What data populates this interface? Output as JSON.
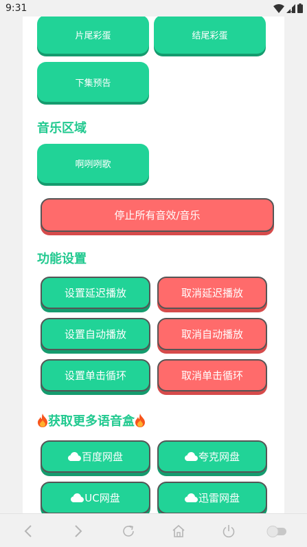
{
  "status_bar": {
    "time": "9:31"
  },
  "top_buttons": {
    "pianwei": "片尾彩蛋",
    "jiewei": "结尾彩蛋",
    "xiaji": "下集预告"
  },
  "music": {
    "title": "音乐区域",
    "song": "啊咧咧歌",
    "stop_all": "停止所有音效/音乐"
  },
  "settings": {
    "title": "功能设置",
    "set_delay": "设置延迟播放",
    "cancel_delay": "取消延迟播放",
    "set_auto": "设置自动播放",
    "cancel_auto": "取消自动播放",
    "set_loop": "设置单击循环",
    "cancel_loop": "取消单击循环"
  },
  "more": {
    "title": "获取更多语音盒",
    "baidu": "百度网盘",
    "quark": "夸克网盘",
    "uc": "UC网盘",
    "xunlei": "迅雷网盘"
  },
  "colors": {
    "accent_green": "#21d397",
    "title_green": "#21c98f",
    "danger_red": "#ff6b6b"
  },
  "icons": [
    "wifi-icon",
    "signal-icon",
    "battery-icon",
    "fire-icon",
    "cloud-icon",
    "back-icon",
    "forward-icon",
    "refresh-icon",
    "home-icon",
    "power-icon",
    "toggle-icon"
  ]
}
